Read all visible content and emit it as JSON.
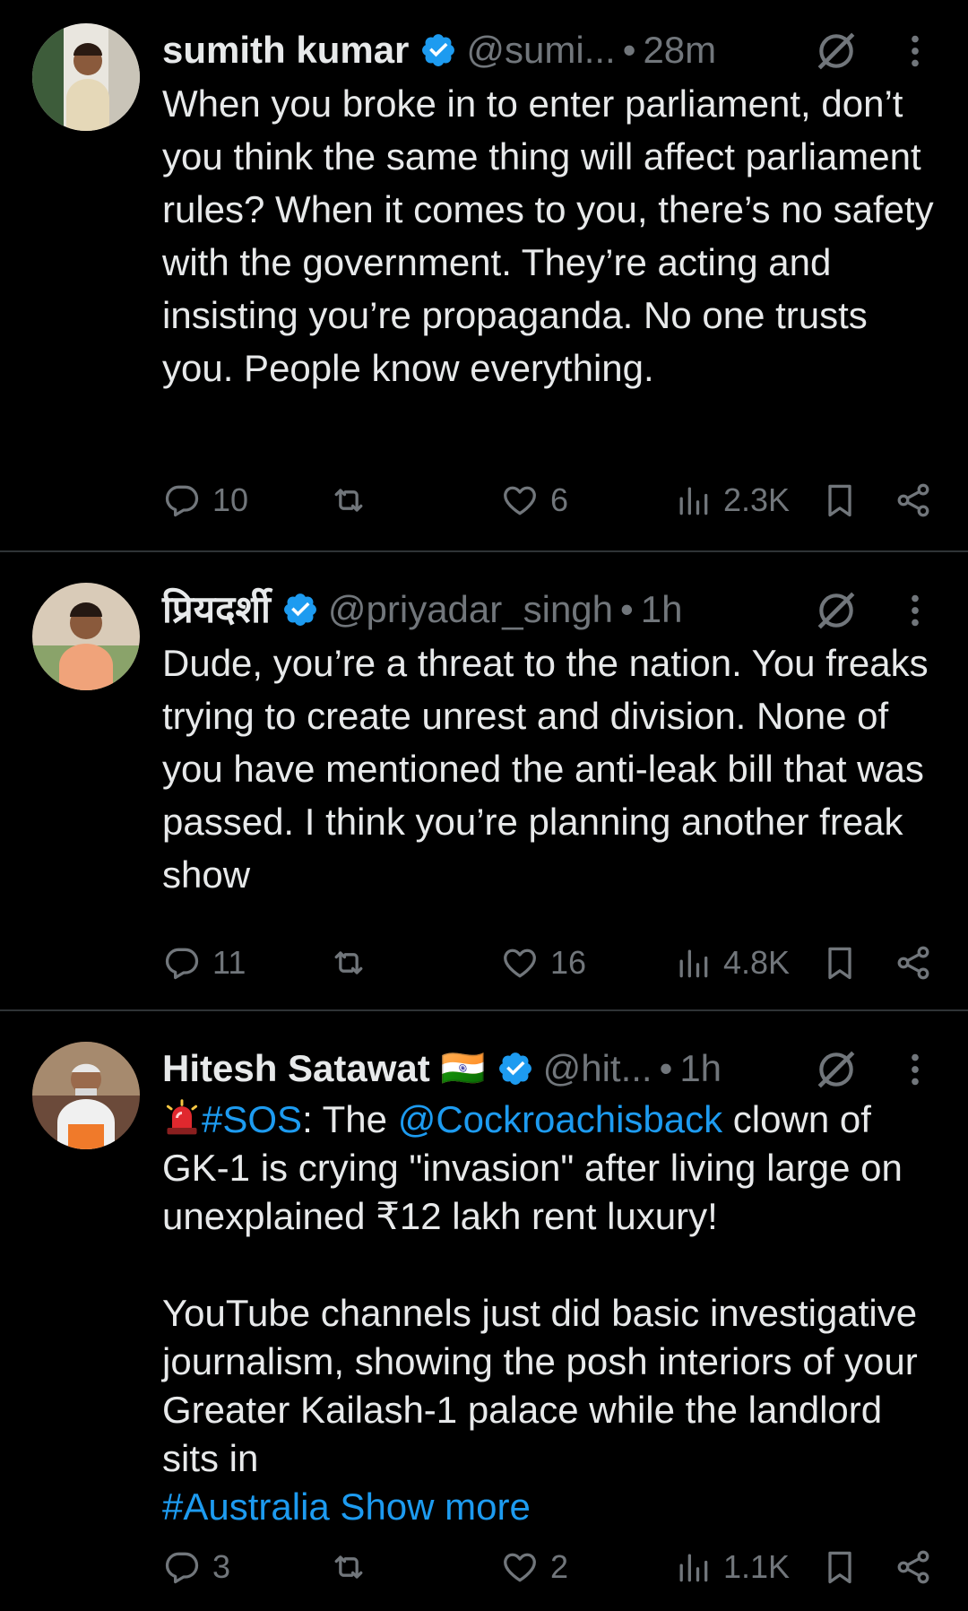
{
  "tweets": [
    {
      "name": "sumith kumar",
      "handle": "@sumi...",
      "time": "28m",
      "body": "When you broke in to enter parliament, don’t you think the same thing will affect parliament rules? When it comes to you, there’s no safety with the government. They’re acting and insisting you’re propaganda. No one trusts you. People know everything.",
      "replies": "10",
      "likes": "6",
      "views": "2.3K"
    },
    {
      "name": "प्रियदर्शी",
      "handle": "@priyadar_singh",
      "time": "1h",
      "body": "Dude, you’re a threat to the nation. You freaks trying to create unrest and division. None of you have mentioned the anti-leak bill that was passed. I think you’re planning another freak show",
      "replies": "11",
      "likes": "16",
      "views": "4.8K"
    },
    {
      "name": "Hitesh Satawat",
      "flag": "🇮🇳",
      "handle": "@hit...",
      "time": "1h",
      "body_parts": {
        "hashtag1": "#SOS",
        "text1": ": The ",
        "mention": "@Cockroachisback",
        "text2": " clown of GK-1 is crying \"invasion\" after living large on unexplained ₹12 lakh rent luxury!\n\nYouTube channels just did basic investigative journalism, showing the posh interiors of your Greater Kailash-1 palace while the landlord sits in\n",
        "hashtag2": "#Australia",
        "show_more": " Show more"
      },
      "replies": "3",
      "likes": "2",
      "views": "1.1K"
    }
  ],
  "separator_dot": "•",
  "icons": {
    "verified": "verified-badge-icon",
    "grok": "grok-icon",
    "more": "more-icon",
    "reply": "reply-icon",
    "retweet": "retweet-icon",
    "like": "like-icon",
    "views": "views-icon",
    "bookmark": "bookmark-icon",
    "share": "share-icon",
    "siren": "siren-icon"
  },
  "colors": {
    "background": "#000000",
    "text": "#e7e9ea",
    "secondary": "#71767b",
    "accent": "#1d9bf0",
    "divider": "#2f3336"
  }
}
